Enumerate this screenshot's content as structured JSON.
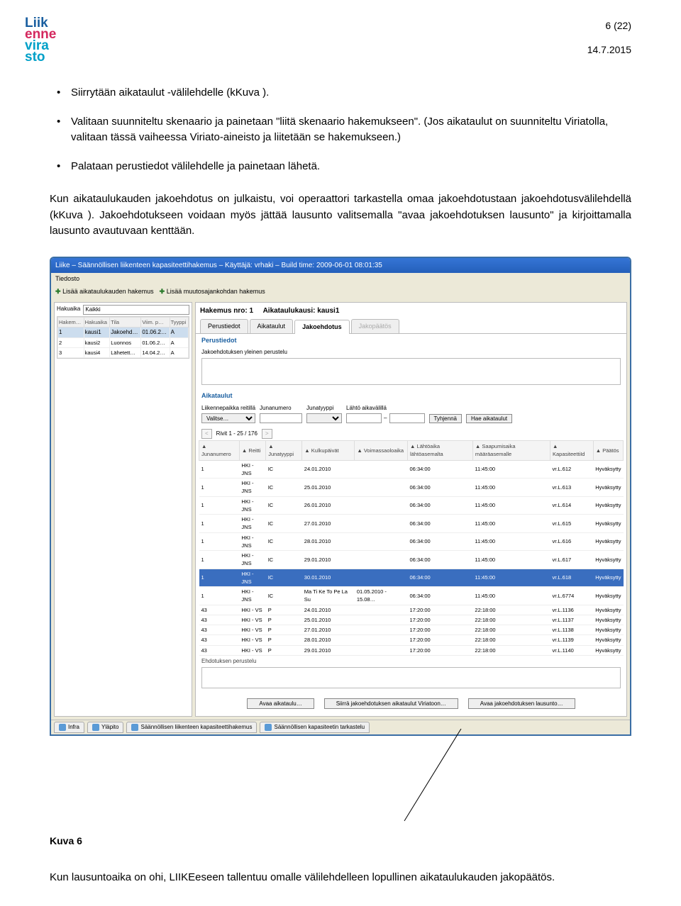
{
  "page_num": "6 (22)",
  "page_date": "14.7.2015",
  "logo": {
    "line1": "Liik",
    "line2": "enne",
    "line3": "vira",
    "line4": "sto"
  },
  "bullets": [
    "Siirrytään aikataulut -välilehdelle (kKuva ).",
    "Valitaan suunniteltu skenaario ja painetaan \"liitä skenaario hakemukseen\". (Jos aikataulut on suunniteltu Viriatolla, valitaan tässä vaiheessa Viriato-aineisto ja liitetään se hakemukseen.)",
    "Palataan perustiedot välilehdelle ja painetaan lähetä."
  ],
  "para1": "Kun aikataulukauden jakoehdotus on julkaistu, voi operaattori tarkastella omaa jakoehdotustaan jakoehdotusvälilehdellä (kKuva ). Jakoehdotukseen voidaan myös jättää lausunto valitsemalla \"avaa jakoehdotuksen lausunto\" ja kirjoittamalla lausunto avautuvaan kenttään.",
  "window": {
    "title": "Liike – Säännöllisen liikenteen kapasiteettihakemus – Käyttäjä: vrhaki – Build time: 2009-06-01 08:01:35",
    "menu": "Tiedosto",
    "toolbar": [
      "Lisää aikataulukauden hakemus",
      "Lisää muutosajankohdan hakemus"
    ],
    "left": {
      "hakuaika_label": "Hakuaika",
      "hakuaika_value": "Kaikki",
      "cols": [
        "Hakem…",
        "Hakuaika",
        "Tila",
        "Viim. p…",
        "Tyyppi"
      ],
      "rows": [
        [
          "1",
          "kausi1",
          "Jakoehd…",
          "01.06.2…",
          "A"
        ],
        [
          "2",
          "kausi2",
          "Luonnos",
          "01.06.2…",
          "A"
        ],
        [
          "3",
          "kausi4",
          "Lähetett…",
          "14.04.2…",
          "A"
        ]
      ]
    },
    "right": {
      "header_hakemus": "Hakemus nro:  1",
      "header_kausi": "Aikataulukausi:  kausi1",
      "tabs": [
        "Perustiedot",
        "Aikataulut",
        "Jakoehdotus",
        "Jakopäätös"
      ],
      "active_tab": 2,
      "sec_perustiedot": "Perustiedot",
      "sec_perustiedot_sub": "Jakoehdotuksen yleinen perustelu",
      "sec_aikataulut": "Aikataulut",
      "filters": {
        "liikennepaikka": "Liikennepaikka reitillä",
        "valitse": "Valitse…",
        "junanumero": "Junanumero",
        "junatyyppi": "Junatyyppi",
        "lahto": "Lähtö aikavälillä",
        "tyhjenna": "Tyhjennä",
        "hae": "Hae aikataulut"
      },
      "pager": "Rivit 1 - 25 / 176",
      "grid_cols": [
        "Junanumero",
        "Reitti",
        "Junatyyppi",
        "Kulkupäivät",
        "Voimassaoloaika",
        "Lähtöaika lähtöasemalta",
        "Saapumisaika määräasemalle",
        "KapasiteettiId",
        "Päätös"
      ],
      "grid_rows": [
        [
          "1",
          "HKI - JNS",
          "IC",
          "24.01.2010",
          "",
          "06:34:00",
          "11:45:00",
          "vr.L.612",
          "Hyväksytty"
        ],
        [
          "1",
          "HKI - JNS",
          "IC",
          "25.01.2010",
          "",
          "06:34:00",
          "11:45:00",
          "vr.L.613",
          "Hyväksytty"
        ],
        [
          "1",
          "HKI - JNS",
          "IC",
          "26.01.2010",
          "",
          "06:34:00",
          "11:45:00",
          "vr.L.614",
          "Hyväksytty"
        ],
        [
          "1",
          "HKI - JNS",
          "IC",
          "27.01.2010",
          "",
          "06:34:00",
          "11:45:00",
          "vr.L.615",
          "Hyväksytty"
        ],
        [
          "1",
          "HKI - JNS",
          "IC",
          "28.01.2010",
          "",
          "06:34:00",
          "11:45:00",
          "vr.L.616",
          "Hyväksytty"
        ],
        [
          "1",
          "HKI - JNS",
          "IC",
          "29.01.2010",
          "",
          "06:34:00",
          "11:45:00",
          "vr.L.617",
          "Hyväksytty"
        ],
        [
          "1",
          "HKI - JNS",
          "IC",
          "30.01.2010",
          "",
          "06:34:00",
          "11:45:00",
          "vr.L.618",
          "Hyväksytty"
        ],
        [
          "1",
          "HKI - JNS",
          "IC",
          "Ma Ti Ke To Pe La Su",
          "01.05.2010 - 15.08…",
          "06:34:00",
          "11:45:00",
          "vr.L.6774",
          "Hyväksytty"
        ],
        [
          "43",
          "HKI - VS",
          "P",
          "24.01.2010",
          "",
          "17:20:00",
          "22:18:00",
          "vr.L.1136",
          "Hyväksytty"
        ],
        [
          "43",
          "HKI - VS",
          "P",
          "25.01.2010",
          "",
          "17:20:00",
          "22:18:00",
          "vr.L.1137",
          "Hyväksytty"
        ],
        [
          "43",
          "HKI - VS",
          "P",
          "27.01.2010",
          "",
          "17:20:00",
          "22:18:00",
          "vr.L.1138",
          "Hyväksytty"
        ],
        [
          "43",
          "HKI - VS",
          "P",
          "28.01.2010",
          "",
          "17:20:00",
          "22:18:00",
          "vr.L.1139",
          "Hyväksytty"
        ],
        [
          "43",
          "HKI - VS",
          "P",
          "29.01.2010",
          "",
          "17:20:00",
          "22:18:00",
          "vr.L.1140",
          "Hyväksytty"
        ]
      ],
      "hl_row": 6,
      "ehdotuksen": "Ehdotuksen perustelu",
      "buttons": [
        "Avaa aikataulu…",
        "Siirrä jakoehdotuksen aikataulut Viriatoon…",
        "Avaa jakoehdotuksen lausunto…"
      ]
    },
    "status_tabs": [
      "Infra",
      "Yläpito",
      "Säännöllisen liikenteen kapasiteettihakemus",
      "Säännöllisen kapasiteetin tarkastelu"
    ]
  },
  "kuva_label": "Kuva 6",
  "footer": "Kun lausuntoaika on ohi, LIIKEeseen tallentuu omalle välilehdelleen lopullinen aikataulukauden jakopäätös."
}
